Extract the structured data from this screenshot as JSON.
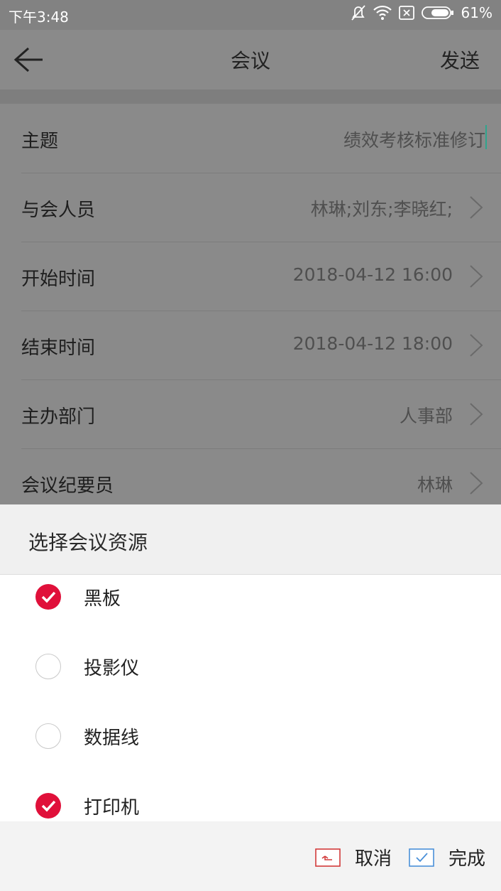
{
  "status_bar": {
    "time": "下午3:48",
    "battery": "61%"
  },
  "nav": {
    "title": "会议",
    "send": "发送"
  },
  "form": {
    "rows": [
      {
        "label": "主题",
        "value": "绩效考核标准修订"
      },
      {
        "label": "与会人员",
        "value": "林琳;刘东;李晓红;"
      },
      {
        "label": "开始时间",
        "value": "2018-04-12 16:00"
      },
      {
        "label": "结束时间",
        "value": "2018-04-12 18:00"
      },
      {
        "label": "主办部门",
        "value": "人事部"
      },
      {
        "label": "会议纪要员",
        "value": "林琳"
      }
    ]
  },
  "sheet": {
    "title": "选择会议资源",
    "items": [
      {
        "label": "黑板",
        "checked": true
      },
      {
        "label": "投影仪",
        "checked": false
      },
      {
        "label": "数据线",
        "checked": false
      },
      {
        "label": "打印机",
        "checked": true
      }
    ],
    "cancel": "取消",
    "done": "完成"
  },
  "colors": {
    "accent": "#e0103a",
    "dim_overlay": "#8a8a8a",
    "done_icon": "#4a90d9"
  }
}
